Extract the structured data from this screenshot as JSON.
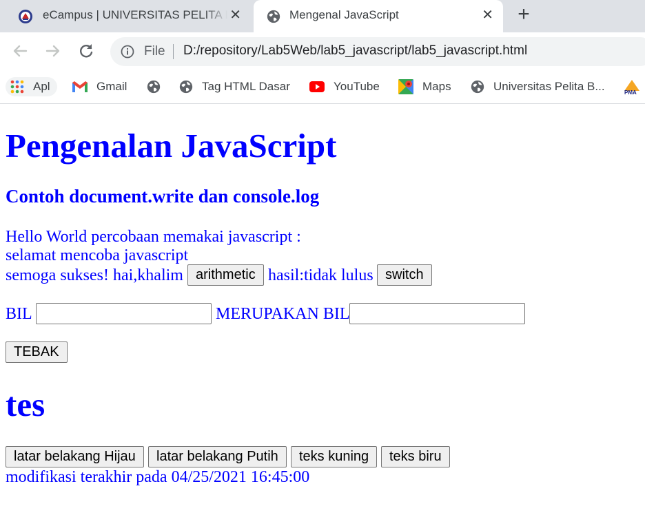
{
  "browser": {
    "tabs": [
      {
        "title": "eCampus | UNIVERSITAS PELITA BANGSA",
        "icon": "university-seal-icon",
        "close": "✕",
        "active": false
      },
      {
        "title": "Mengenal JavaScript",
        "icon": "globe-icon",
        "close": "✕",
        "active": true
      }
    ],
    "new_tab": "+",
    "address": {
      "security_label": "File",
      "url": "D:/repository/Lab5Web/lab5_javascript/lab5_javascript.html"
    },
    "bookmarks": [
      {
        "label": "Apl",
        "icon": "apps-grid-icon"
      },
      {
        "label": "Gmail",
        "icon": "gmail-icon"
      },
      {
        "label": "",
        "icon": "globe-icon"
      },
      {
        "label": "Tag HTML Dasar",
        "icon": "globe-icon"
      },
      {
        "label": "YouTube",
        "icon": "youtube-icon"
      },
      {
        "label": "Maps",
        "icon": "maps-icon"
      },
      {
        "label": "Universitas Pelita B...",
        "icon": "globe-icon"
      },
      {
        "label": "",
        "icon": "pma-logo-icon"
      }
    ]
  },
  "page": {
    "title": "Pengenalan JavaScript",
    "subtitle": "Contoh document.write dan console.log",
    "line1": "Hello World percobaan memakai javascript :",
    "line2": "selamat mencoba javascript",
    "line3_prefix": "semoga sukses! hai,khalim",
    "arithmetic_button": "arithmetic",
    "hasil_text": "hasil:tidak lulus",
    "switch_button": "switch",
    "bil_label": "BIL",
    "bil_value": "",
    "merupakan_label": "MERUPAKAN BIL",
    "merupakan_value": "",
    "tebak_button": "TEBAK",
    "heading_tes": "tes",
    "color_buttons": [
      "latar belakang Hijau",
      "latar belakang Putih",
      "teks kuning",
      "teks biru"
    ],
    "last_modified": "modifikasi terakhir pada 04/25/2021 16:45:00"
  },
  "colors": {
    "page_text": "#0000ff",
    "tabstrip": "#dee1e6",
    "omnibox": "#f1f3f4"
  }
}
